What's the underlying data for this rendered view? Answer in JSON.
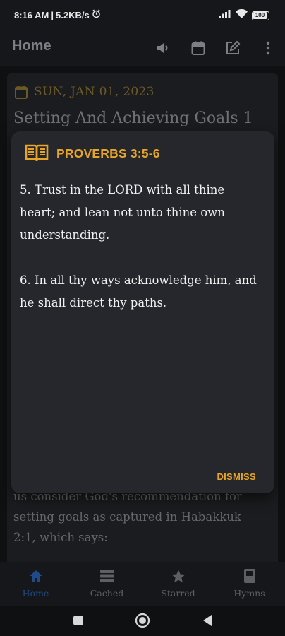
{
  "status_bar": {
    "time": "8:16 AM",
    "speed": "5.2KB/s",
    "battery": "100"
  },
  "app_bar": {
    "title": "Home"
  },
  "background": {
    "date": "SUN, JAN 01, 2023",
    "title": "Setting And Achieving Goals 1",
    "body_lines": [
      "us consider God's recommendation for",
      "setting goals as captured in Habakkuk",
      "2:1, which says:"
    ]
  },
  "dialog": {
    "reference": "PROVERBS 3:5-6",
    "verses": [
      "5. Trust in the LORD with all thine heart; and lean not unto thine own understanding.",
      "6. In all thy ways acknowledge him, and he shall direct thy paths."
    ],
    "dismiss_label": "DISMISS"
  },
  "bottom_nav": {
    "items": [
      {
        "label": "Home",
        "icon": "home-icon",
        "active": true
      },
      {
        "label": "Cached",
        "icon": "cached-icon",
        "active": false
      },
      {
        "label": "Starred",
        "icon": "star-icon",
        "active": false
      },
      {
        "label": "Hymns",
        "icon": "hymn-book-icon",
        "active": false
      }
    ]
  },
  "colors": {
    "accent": "#e7a528",
    "active_nav": "#1f4b86",
    "dialog_bg": "#25272c"
  }
}
